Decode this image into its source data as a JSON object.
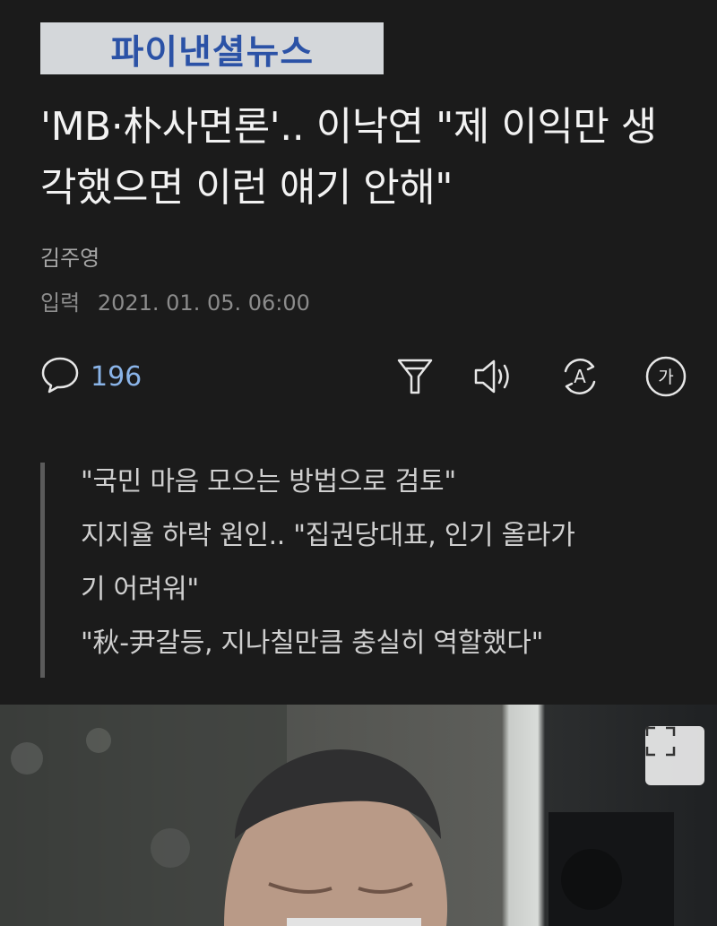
{
  "header": {
    "logo_text": "파이낸셜뉴스"
  },
  "article": {
    "headline": "'MB·朴사면론'.. 이낙연 \"제 이익만 생각했으면 이런 얘기 안해\"",
    "author": "김주영",
    "date_label": "입력",
    "date_value": "2021. 01. 05. 06:00",
    "summary": [
      "\"국민 마음 모으는 방법으로 검토\"",
      "지지율 하락 원인.. \"집권당대표, 인기 올라가",
      "기 어려워\"",
      "\"秋-尹갈등, 지나칠만큼 충실히 역할했다\""
    ]
  },
  "toolbar": {
    "comment_count": "196",
    "icons": [
      "speech-bubble-icon",
      "filter-icon",
      "speaker-icon",
      "translate-icon",
      "font-size-icon"
    ],
    "font_size_glyph": "가",
    "translate_glyph": "A"
  },
  "photo": {
    "expand_icon": "expand-icon"
  },
  "colors": {
    "background": "#1b1b1b",
    "logo_blue": "#2b52a6",
    "comment_count": "#8ab4e8"
  }
}
